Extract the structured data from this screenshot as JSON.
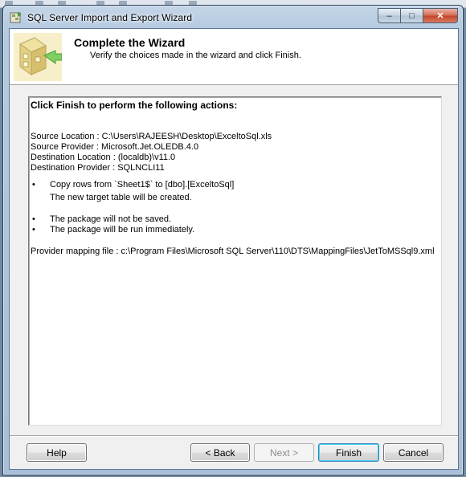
{
  "window": {
    "title": "SQL Server Import and Export Wizard",
    "controls": {
      "minimize": "–",
      "maximize": "□",
      "close": "✕"
    }
  },
  "header": {
    "title": "Complete the Wizard",
    "subtitle": "Verify the choices made in the wizard and click Finish."
  },
  "summary": {
    "heading": "Click Finish to perform the following actions:",
    "details": [
      "Source Location : C:\\Users\\RAJEESH\\Desktop\\ExceltoSql.xls",
      "Source Provider : Microsoft.Jet.OLEDB.4.0",
      "Destination Location : (localdb)\\v11.0",
      "Destination Provider : SQLNCLI11"
    ],
    "bullet_mark": "•",
    "copy_action": "Copy rows from `Sheet1$` to [dbo].[ExceltoSql]",
    "copy_note": "The new target table will be created.",
    "package_saved": "The package will not be saved.",
    "package_run": "The package will be run immediately.",
    "mapping_file": "Provider mapping file : c:\\Program Files\\Microsoft SQL Server\\110\\DTS\\MappingFiles\\JetToMSSql9.xml"
  },
  "buttons": {
    "help": "Help",
    "back": "< Back",
    "next": "Next >",
    "finish": "Finish",
    "cancel": "Cancel"
  },
  "icons": {
    "app": "wizard-app-icon",
    "header": "package-arrow-icon"
  },
  "colors": {
    "title_bar": "#b5c9df",
    "close_button": "#c14529",
    "default_button_border": "#3c7fb1"
  }
}
